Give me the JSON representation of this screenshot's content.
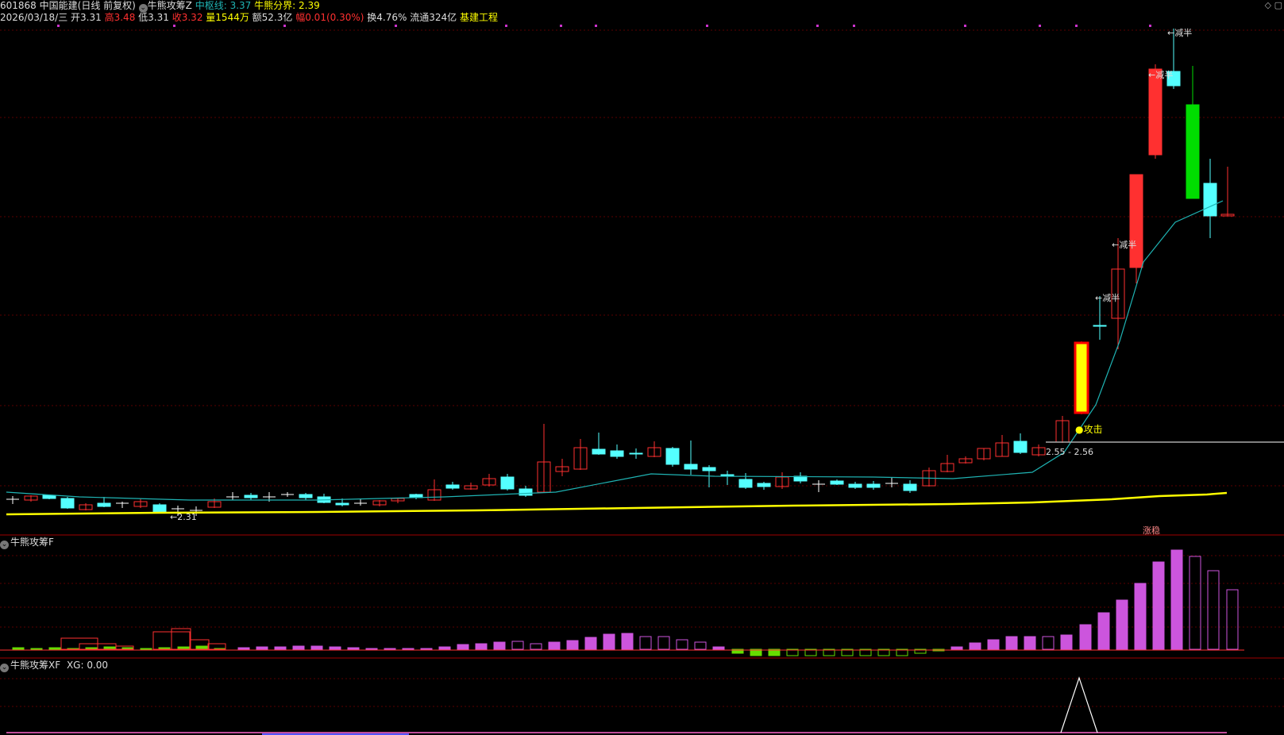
{
  "header": {
    "code": "601868",
    "name": "中国能建",
    "period": "(日线 前复权)",
    "indicator": "牛熊攻筹Z",
    "mid_label": "中枢线: 3.37",
    "bound_label": "牛熊分界: 2.39",
    "date": "2026/03/18/三",
    "open": "开3.31",
    "high": "高3.48",
    "low": "低3.31",
    "close": "收3.32",
    "volume": "量1544万",
    "amount": "额52.3亿",
    "change": "幅0.01(0.30%)",
    "turnover": "换4.76%",
    "float": "流通324亿",
    "sector": "基建工程"
  },
  "toolbar": {
    "icons": [
      "diamond-icon",
      "window-icon"
    ]
  },
  "main_chart": {
    "annotations": {
      "low_marker": "←2.31",
      "attack": "●攻击",
      "range": "2.55 - 2.56",
      "half1": "←减半",
      "half2": "←减半",
      "half3": "←减半",
      "half4": "←减半",
      "limit_up": "涨稳"
    }
  },
  "panel_f": {
    "title": "牛熊攻筹F"
  },
  "panel_xf": {
    "title": "牛熊攻筹XF",
    "value": "XG: 0.00"
  },
  "colors": {
    "up": "#ff3030",
    "down": "#54ffff",
    "mid_line": "#1fb3b3",
    "bound_line": "#ffff00",
    "bar": "#cc55dd",
    "neg_bar": "#66dd00"
  }
}
